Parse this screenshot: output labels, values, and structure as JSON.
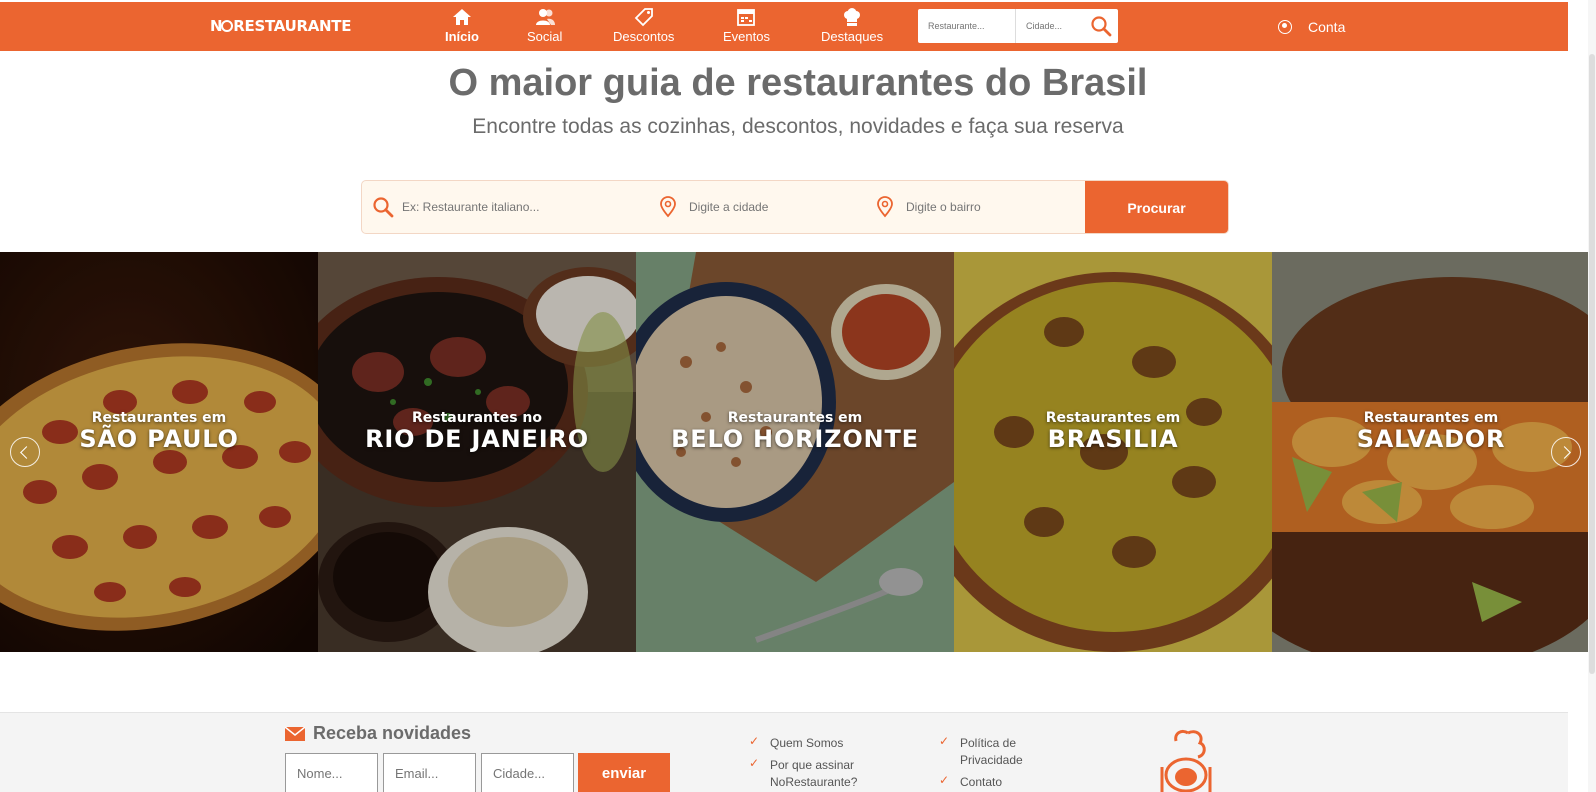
{
  "navbar": {
    "logo": "NORESTAURANTE",
    "items": [
      {
        "label": "Início",
        "icon": "home-icon",
        "active": true
      },
      {
        "label": "Social",
        "icon": "users-icon",
        "active": false
      },
      {
        "label": "Descontos",
        "icon": "tag-icon",
        "active": false
      },
      {
        "label": "Eventos",
        "icon": "calendar-icon",
        "active": false
      },
      {
        "label": "Destaques",
        "icon": "chef-hat-icon",
        "active": false
      }
    ],
    "search": {
      "restaurant_placeholder": "Restaurante...",
      "city_placeholder": "Cidade..."
    },
    "account_label": "Conta"
  },
  "hero": {
    "title": "O maior guia de restaurantes do Brasil",
    "subtitle": "Encontre todas as cozinhas, descontos, novidades e faça sua reserva"
  },
  "search": {
    "query_placeholder": "Ex: Restaurante italiano...",
    "city_placeholder": "Digite a cidade",
    "neighborhood_placeholder": "Digite o bairro",
    "button": "Procurar"
  },
  "carousel": {
    "slides": [
      {
        "pre": "Restaurantes em",
        "city": "SÃO PAULO",
        "food": "pizza"
      },
      {
        "pre": "Restaurantes no",
        "city": "RIO DE JANEIRO",
        "food": "feijoada"
      },
      {
        "pre": "Restaurantes em",
        "city": "BELO HORIZONTE",
        "food": "tutu"
      },
      {
        "pre": "Restaurantes em",
        "city": "BRASILIA",
        "food": "arroz com pequi"
      },
      {
        "pre": "Restaurantes em",
        "city": "SALVADOR",
        "food": "acarajé"
      }
    ]
  },
  "footer": {
    "newsletter": {
      "title": "Receba novidades",
      "name_placeholder": "Nome...",
      "email_placeholder": "Email...",
      "city_placeholder": "Cidade...",
      "button": "enviar"
    },
    "links_col1": [
      "Quem Somos",
      "Por que assinar NoRestaurante?"
    ],
    "links_col2": [
      "Política de Privacidade",
      "Contato"
    ]
  },
  "colors": {
    "brand": "#eb6530",
    "text": "#6b6b6b",
    "search_bg": "#fff8ee"
  }
}
